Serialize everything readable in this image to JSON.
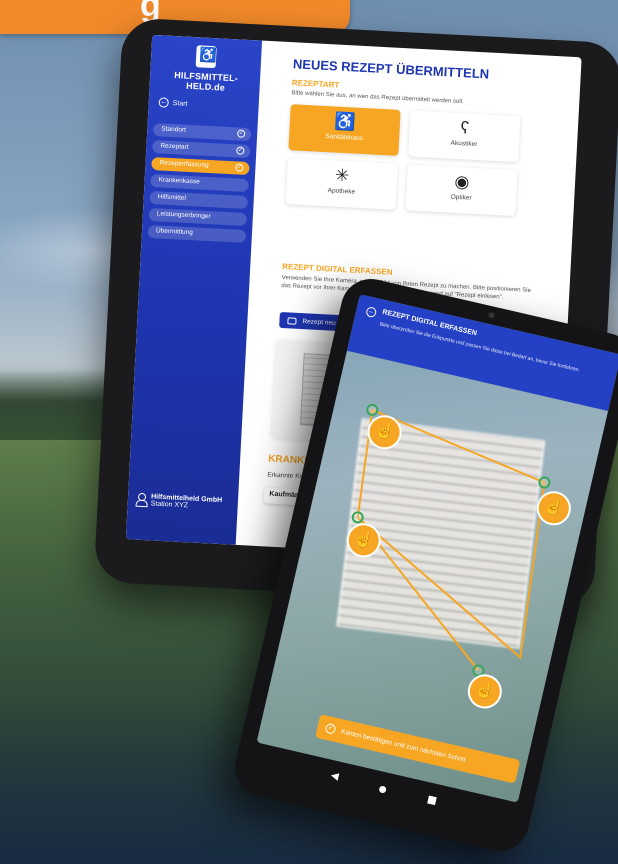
{
  "header": {
    "title_fragment": "g"
  },
  "tablet_main": {
    "sidebar": {
      "brand": "HILFSMITTEL-HELD.de",
      "start_label": "Start",
      "nav_items": [
        {
          "label": "Standort",
          "state": "done"
        },
        {
          "label": "Rezeptart",
          "state": "done"
        },
        {
          "label": "Rezepterfassung",
          "state": "active"
        },
        {
          "label": "Krankenkasse",
          "state": "todo"
        },
        {
          "label": "Hilfsmittel",
          "state": "todo"
        },
        {
          "label": "Leistungserbringer",
          "state": "todo"
        },
        {
          "label": "Übermittlung",
          "state": "todo"
        }
      ],
      "company_name": "Hilfsmittelheld GmbH",
      "company_station": "Station XYZ"
    },
    "main": {
      "title": "NEUES REZEPT ÜBERMITTELN",
      "rezeptart_label": "REZEPTART",
      "rezeptart_desc": "Bitte wählen Sie aus, an wen das Rezept übermittelt werden soll.",
      "tiles": [
        {
          "label": "Sanitätshaus",
          "icon": "wheelchair-icon",
          "selected": true
        },
        {
          "label": "Akustiker",
          "icon": "ear-icon",
          "selected": false
        },
        {
          "label": "Apotheke",
          "icon": "pharmacy-icon",
          "selected": false
        },
        {
          "label": "Optiker",
          "icon": "eye-icon",
          "selected": false
        }
      ],
      "digital_label": "REZEPT DIGITAL ERFASSEN",
      "digital_desc": "Verwenden Sie Ihre Kamera, um ein Bild von Ihrem Rezept zu machen. Bitte positionieren Sie das Rezept vor Ihrer Kamera und drücken Sie anschliessend auf \"Rezept einlesen\".",
      "scan_button": "Rezept neu einlesen",
      "kk_label": "KRANKENKASSE WA",
      "kk_sub": "Erkannte Krankenkasse",
      "kk_value": "Kaufmännische Kranke"
    }
  },
  "tablet_scan": {
    "title": "REZEPT DIGITAL ERFASSEN",
    "desc": "Bitte überprüfen Sie die Eckpunkte und passen Sie diese bei Bedarf an, bevor Sie fortfahren.",
    "confirm_button": "Kanten bestätigen und zum nächsten Schritt"
  },
  "colors": {
    "brand_blue": "#2440c4",
    "accent_orange": "#f6a623",
    "header_orange": "#f28a2a",
    "check_green": "#3aa65a"
  }
}
